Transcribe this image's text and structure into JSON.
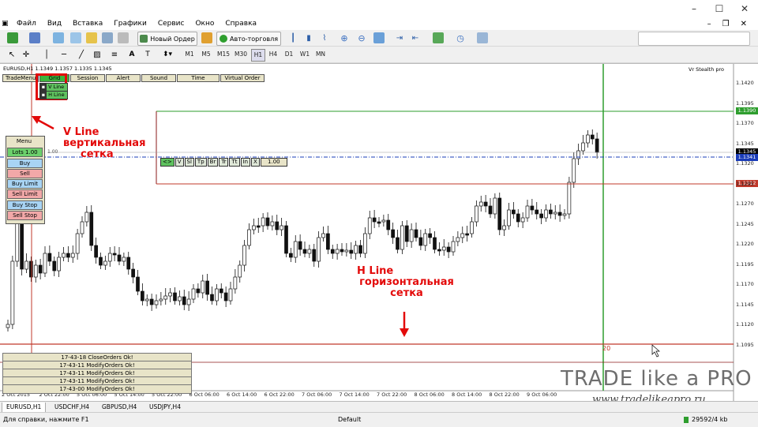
{
  "window": {
    "minimize": "–",
    "maximize": "☐",
    "close": "✕"
  },
  "inner_window": {
    "minimize": "–",
    "restore": "❐",
    "close": "✕"
  },
  "menu": [
    "Файл",
    "Вид",
    "Вставка",
    "Графики",
    "Сервис",
    "Окно",
    "Справка"
  ],
  "toolbar": {
    "new_order": "Новый Ордер",
    "autotrading": "Авто-торговля",
    "timeframes": [
      "M1",
      "M5",
      "M15",
      "M30",
      "H1",
      "H4",
      "D1",
      "W1",
      "MN"
    ]
  },
  "chart": {
    "symbol_info": "EURUSD,H1  1.1349 1.1357 1.1335 1.1345",
    "indicator_name": "Vr Stealth pro",
    "top_buttons": [
      "TradeMenu",
      "Grid",
      "Session",
      "Alert",
      "Sound",
      "Time",
      "Virtual Order"
    ],
    "grid_sub": [
      "V Line",
      "H Line"
    ],
    "panel_title": "Menu",
    "lots": "Lots 1.00",
    "panel_buttons": [
      "Buy",
      "Sell",
      "Buy Limit",
      "Sell Limit",
      "Buy Stop",
      "Sell Stop"
    ],
    "trade_panel_buttons": [
      "<>",
      "V",
      "Sl",
      "Tp",
      "Br",
      "Tr",
      "Tt",
      "In",
      "X"
    ],
    "trade_panel_lots": "1.00",
    "level_label": "1.00",
    "counter": "20",
    "price_labels": {
      "green": "1.1390",
      "bid": "1.1345",
      "blue": "1.1341",
      "red": "1.1312"
    },
    "y_ticks": [
      "1.1420",
      "1.1395",
      "1.1370",
      "1.1345",
      "1.1320",
      "1.1295",
      "1.1270",
      "1.1245",
      "1.1220",
      "1.1195",
      "1.1170",
      "1.1145",
      "1.1120",
      "1.1095"
    ],
    "x_ticks": [
      "2 Oct 2015",
      "2 Oct 22:00",
      "5 Oct 06:00",
      "5 Oct 14:00",
      "5 Oct 22:00",
      "6 Oct 06:00",
      "6 Oct 14:00",
      "6 Oct 22:00",
      "7 Oct 06:00",
      "7 Oct 14:00",
      "7 Oct 22:00",
      "8 Oct 06:00",
      "8 Oct 14:00",
      "8 Oct 22:00",
      "9 Oct 06:00"
    ],
    "log_messages": [
      "17-43-18 CloseOrders Ok!",
      "17-43-11 ModifyOrders Ok!",
      "17-43-11 ModifyOrders Ok!",
      "17-43-11 ModifyOrders Ok!",
      "17-43-00 ModifyOrders Ok!"
    ]
  },
  "annotations": {
    "vline": {
      "title": "V Line",
      "line1": "вертикальная",
      "line2": "сетка"
    },
    "hline": {
      "title": "H Line",
      "line1": "горизонтальная",
      "line2": "сетка"
    }
  },
  "watermark": {
    "brand": "TRADE like a PRO",
    "url": "www.tradelikeapro.ru"
  },
  "tabs": [
    "EURUSD,H1",
    "USDCHF,H4",
    "GBPUSD,H4",
    "USDJPY,H4"
  ],
  "status": {
    "help": "Для справки, нажмите F1",
    "profile": "Default",
    "traffic": "29592/4 kb"
  },
  "colors": {
    "bull": "#1a1a1a",
    "bear": "#1a1a1a",
    "grid_red": "#c0392b",
    "grid_green": "#2e9e2e",
    "annotation": "#e30a0a"
  }
}
